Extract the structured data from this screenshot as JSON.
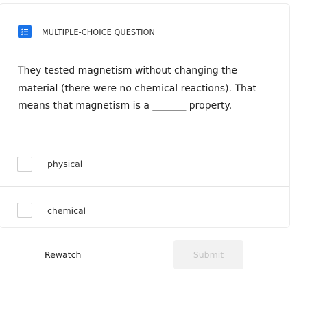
{
  "question": {
    "type_label": "MULTIPLE-CHOICE QUESTION",
    "text": "They tested magnetism without changing the material (there were no chemical reactions).  That means that magnetism is a _______ property.",
    "type_icon": "checklist-icon",
    "accent_color": "#1a73e8"
  },
  "options": [
    {
      "label": "physical",
      "checked": false
    },
    {
      "label": "chemical",
      "checked": false
    }
  ],
  "actions": {
    "rewatch_label": "Rewatch",
    "submit_label": "Submit"
  }
}
